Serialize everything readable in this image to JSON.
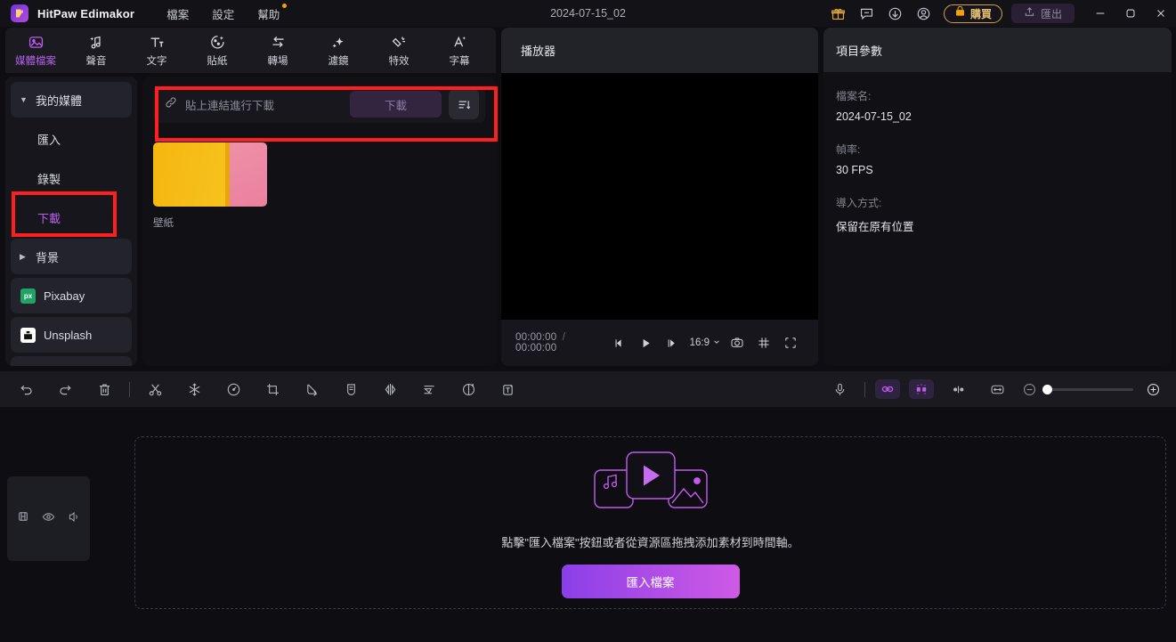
{
  "titlebar": {
    "app_name": "HitPaw Edimakor",
    "logo_icon": "hitpaw-logo-icon",
    "menus": [
      {
        "label": "檔案",
        "name": "menu-file",
        "dot": false
      },
      {
        "label": "設定",
        "name": "menu-settings",
        "dot": false
      },
      {
        "label": "幫助",
        "name": "menu-help",
        "dot": true
      }
    ],
    "document_title": "2024-07-15_02",
    "icons": [
      {
        "name": "gift-icon",
        "glyph": "gift"
      },
      {
        "name": "feedback-icon",
        "glyph": "chat"
      },
      {
        "name": "download-icon",
        "glyph": "arrow-down-circle"
      },
      {
        "name": "account-icon",
        "glyph": "person-circle"
      }
    ],
    "buy_label": "購買",
    "buy_icon": "cart-icon",
    "export_label": "匯出",
    "export_icon": "upload-icon",
    "window_buttons": [
      {
        "name": "minimize-button",
        "glyph": "minimize"
      },
      {
        "name": "maximize-button",
        "glyph": "maximize"
      },
      {
        "name": "close-button",
        "glyph": "close"
      }
    ],
    "accent_gold": "#e7c173"
  },
  "tabs": [
    {
      "label": "媒體檔案",
      "icon": "media-icon",
      "active": true
    },
    {
      "label": "聲音",
      "icon": "audio-note-icon",
      "active": false
    },
    {
      "label": "文字",
      "icon": "text-icon",
      "active": false
    },
    {
      "label": "貼紙",
      "icon": "sticker-icon",
      "active": false
    },
    {
      "label": "轉場",
      "icon": "transition-icon",
      "active": false
    },
    {
      "label": "濾鏡",
      "icon": "filter-sparkle-icon",
      "active": false
    },
    {
      "label": "特效",
      "icon": "effects-icon",
      "active": false
    },
    {
      "label": "字幕",
      "icon": "subtitle-icon",
      "active": false
    }
  ],
  "sidebar": {
    "items": [
      {
        "label": "我的媒體",
        "type": "group",
        "expanded": true,
        "name": "sidebar-item-my-media"
      },
      {
        "label": "匯入",
        "type": "sub",
        "active": false,
        "name": "sidebar-item-import"
      },
      {
        "label": "錄製",
        "type": "sub",
        "active": false,
        "name": "sidebar-item-record"
      },
      {
        "label": "下載",
        "type": "sub",
        "active": true,
        "name": "sidebar-item-download"
      },
      {
        "label": "背景",
        "type": "group",
        "expanded": false,
        "name": "sidebar-item-background"
      },
      {
        "label": "Pixabay",
        "type": "chip",
        "icon": "pixabay-icon",
        "name": "sidebar-item-pixabay"
      },
      {
        "label": "Unsplash",
        "type": "chip",
        "icon": "unsplash-icon",
        "name": "sidebar-item-unsplash"
      }
    ],
    "active_color": "#b561ea"
  },
  "media_panel": {
    "download_placeholder": "貼上連結進行下載",
    "link_icon": "link-icon",
    "download_button_label": "下載",
    "sort_icon": "sort-list-icon",
    "items": [
      {
        "label": "壁紙",
        "name": "media-thumbnail-wallpaper"
      }
    ]
  },
  "player": {
    "title": "播放器",
    "current_time": "00:00:00",
    "total_time": "00:00:00",
    "time_separator": "/",
    "controls": [
      {
        "name": "prev-frame-button",
        "glyph": "prev-frame"
      },
      {
        "name": "play-button",
        "glyph": "play"
      },
      {
        "name": "next-frame-button",
        "glyph": "next-frame"
      }
    ],
    "aspect_ratio": "16:9",
    "right_controls": [
      {
        "name": "snapshot-icon",
        "glyph": "camera"
      },
      {
        "name": "grid-icon",
        "glyph": "grid"
      },
      {
        "name": "fullscreen-icon",
        "glyph": "fullscreen"
      }
    ]
  },
  "inspector": {
    "title": "項目參數",
    "fields": [
      {
        "label": "檔案名:",
        "value": "2024-07-15_02",
        "name": "field-filename"
      },
      {
        "label": "幀率:",
        "value": "30 FPS",
        "name": "field-framerate"
      },
      {
        "label": "導入方式:",
        "value": "保留在原有位置",
        "name": "field-import-mode"
      }
    ]
  },
  "edit_toolbar": {
    "left_tools": [
      {
        "name": "undo-button",
        "glyph": "undo"
      },
      {
        "name": "redo-button",
        "glyph": "redo"
      },
      {
        "name": "delete-button",
        "glyph": "trash"
      },
      {
        "name": "divider",
        "glyph": "divider"
      },
      {
        "name": "split-button",
        "glyph": "scissors"
      },
      {
        "name": "freeze-frame-button",
        "glyph": "snowflake"
      },
      {
        "name": "speed-button",
        "glyph": "speedometer"
      },
      {
        "name": "crop-button",
        "glyph": "crop"
      },
      {
        "name": "animation-button",
        "glyph": "arrow-corner"
      },
      {
        "name": "mask-button",
        "glyph": "shield"
      },
      {
        "name": "mirror-button",
        "glyph": "mirror"
      },
      {
        "name": "align-button",
        "glyph": "align"
      },
      {
        "name": "rotate-button",
        "glyph": "rotate"
      },
      {
        "name": "add-text-button",
        "glyph": "text-box"
      }
    ],
    "right_tools": [
      {
        "name": "voiceover-button",
        "glyph": "microphone",
        "active": false
      },
      {
        "name": "divider",
        "glyph": "divider",
        "active": false
      },
      {
        "name": "link-clips-button",
        "glyph": "link",
        "active": true
      },
      {
        "name": "snap-button",
        "glyph": "magnet",
        "active": true
      },
      {
        "name": "markers-button",
        "glyph": "markers",
        "active": false
      },
      {
        "name": "fit-timeline-button",
        "glyph": "fit-width",
        "active": false
      }
    ],
    "zoom_out_label": "−",
    "zoom_in_label": "+",
    "zoom_value": 0,
    "active_color": "#c05bf0"
  },
  "timeline": {
    "track_header_icons": [
      {
        "name": "lock-icon",
        "glyph": "lock"
      },
      {
        "name": "visibility-icon",
        "glyph": "eye"
      },
      {
        "name": "mute-icon",
        "glyph": "speaker"
      }
    ],
    "dropzone_text": "點擊\"匯入檔案\"按鈕或者從資源區拖拽添加素材到時間軸。",
    "import_button_label": "匯入檔案",
    "media_art_icon": "media-placeholder-icon",
    "gradient_start": "#8b3fe8",
    "gradient_end": "#cf5ae6"
  },
  "annotations": [
    {
      "name": "annotation-download-sidebar",
      "color": "#ff1f1f"
    },
    {
      "name": "annotation-download-bar",
      "color": "#ff1f1f"
    }
  ]
}
